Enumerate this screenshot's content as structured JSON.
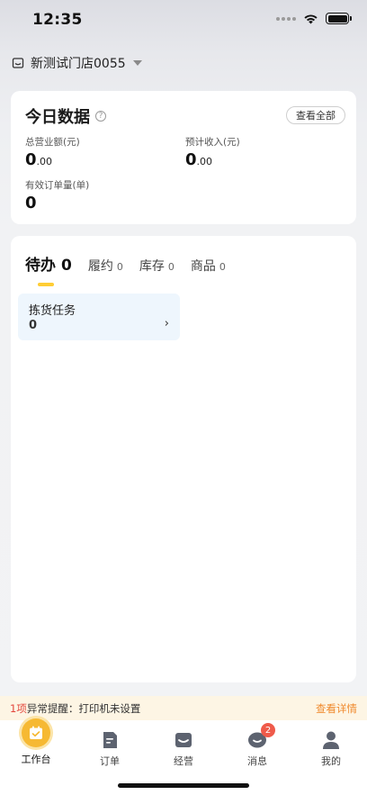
{
  "status_bar": {
    "time": "12:35"
  },
  "store": {
    "name": "新测试门店0055"
  },
  "today": {
    "title": "今日数据",
    "help_icon": "question-circle-icon",
    "view_all": "查看全部",
    "metrics": [
      {
        "label": "总营业额(元)",
        "value_int": "0",
        "value_dec": ".00"
      },
      {
        "label": "预计收入(元)",
        "value_int": "0",
        "value_dec": ".00"
      },
      {
        "label": "有效订单量(单)",
        "value_int": "0",
        "value_dec": ""
      }
    ]
  },
  "todo": {
    "tabs": [
      {
        "label": "待办",
        "count": "0",
        "active": true
      },
      {
        "label": "履约",
        "count": "0"
      },
      {
        "label": "库存",
        "count": "0"
      },
      {
        "label": "商品",
        "count": "0"
      }
    ],
    "task": {
      "name": "拣货任务",
      "count": "0",
      "chevron": "›"
    }
  },
  "alert": {
    "count": "1项",
    "text": "异常提醒：打印机未设置",
    "link": "查看详情"
  },
  "nav": {
    "items": [
      {
        "label": "工作台",
        "icon": "calendar-check-icon",
        "active": true
      },
      {
        "label": "订单",
        "icon": "document-icon"
      },
      {
        "label": "经营",
        "icon": "inbox-icon"
      },
      {
        "label": "消息",
        "icon": "chat-bubble-icon",
        "badge": "2"
      },
      {
        "label": "我的",
        "icon": "person-icon"
      }
    ]
  },
  "colors": {
    "accent": "#ffcd34",
    "alert_red": "#e3463c",
    "link_orange": "#f0892c",
    "badge_red": "#ef5a4a"
  }
}
